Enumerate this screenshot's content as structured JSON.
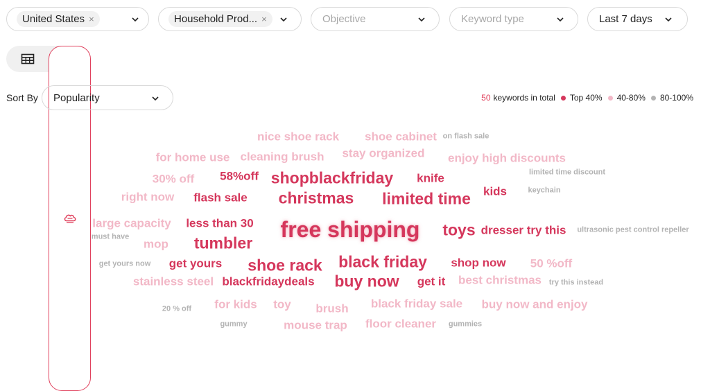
{
  "filters": {
    "country": "United States",
    "category": "Household Prod...",
    "objective_placeholder": "Objective",
    "keyword_type_placeholder": "Keyword type",
    "date_range": "Last 7 days"
  },
  "sort": {
    "label": "Sort By",
    "value": "Popularity"
  },
  "legend": {
    "count": "50",
    "count_suffix": "keywords in total",
    "tiers": [
      "Top 40%",
      "40-80%",
      "80-100%"
    ],
    "colors": {
      "top": "#d5375c",
      "mid": "#f2b8c7",
      "low": "#b3b3b3"
    }
  },
  "keywords": [
    "nice shoe rack",
    "shoe cabinet",
    "on flash sale",
    "for home use",
    "cleaning brush",
    "stay organized",
    "enjoy high discounts",
    "30% off",
    "58%off",
    "shopblackfriday",
    "knife",
    "limited time discount",
    "right now",
    "flash sale",
    "christmas",
    "limited time",
    "kids",
    "keychain",
    "large capacity",
    "less than 30",
    "free shipping",
    "toys",
    "dresser try this",
    "ultrasonic pest control repeller",
    "must have",
    "mop",
    "tumbler",
    "get yours now",
    "get yours",
    "shoe rack",
    "black friday",
    "shop now",
    "50 %off",
    "stainless steel",
    "blackfridaydeals",
    "buy now",
    "get it",
    "best christmas",
    "try this instead",
    "20 % off",
    "for kids",
    "toy",
    "brush",
    "black friday sale",
    "buy now and enjoy",
    "gummy",
    "mouse trap",
    "floor cleaner",
    "gummies"
  ]
}
